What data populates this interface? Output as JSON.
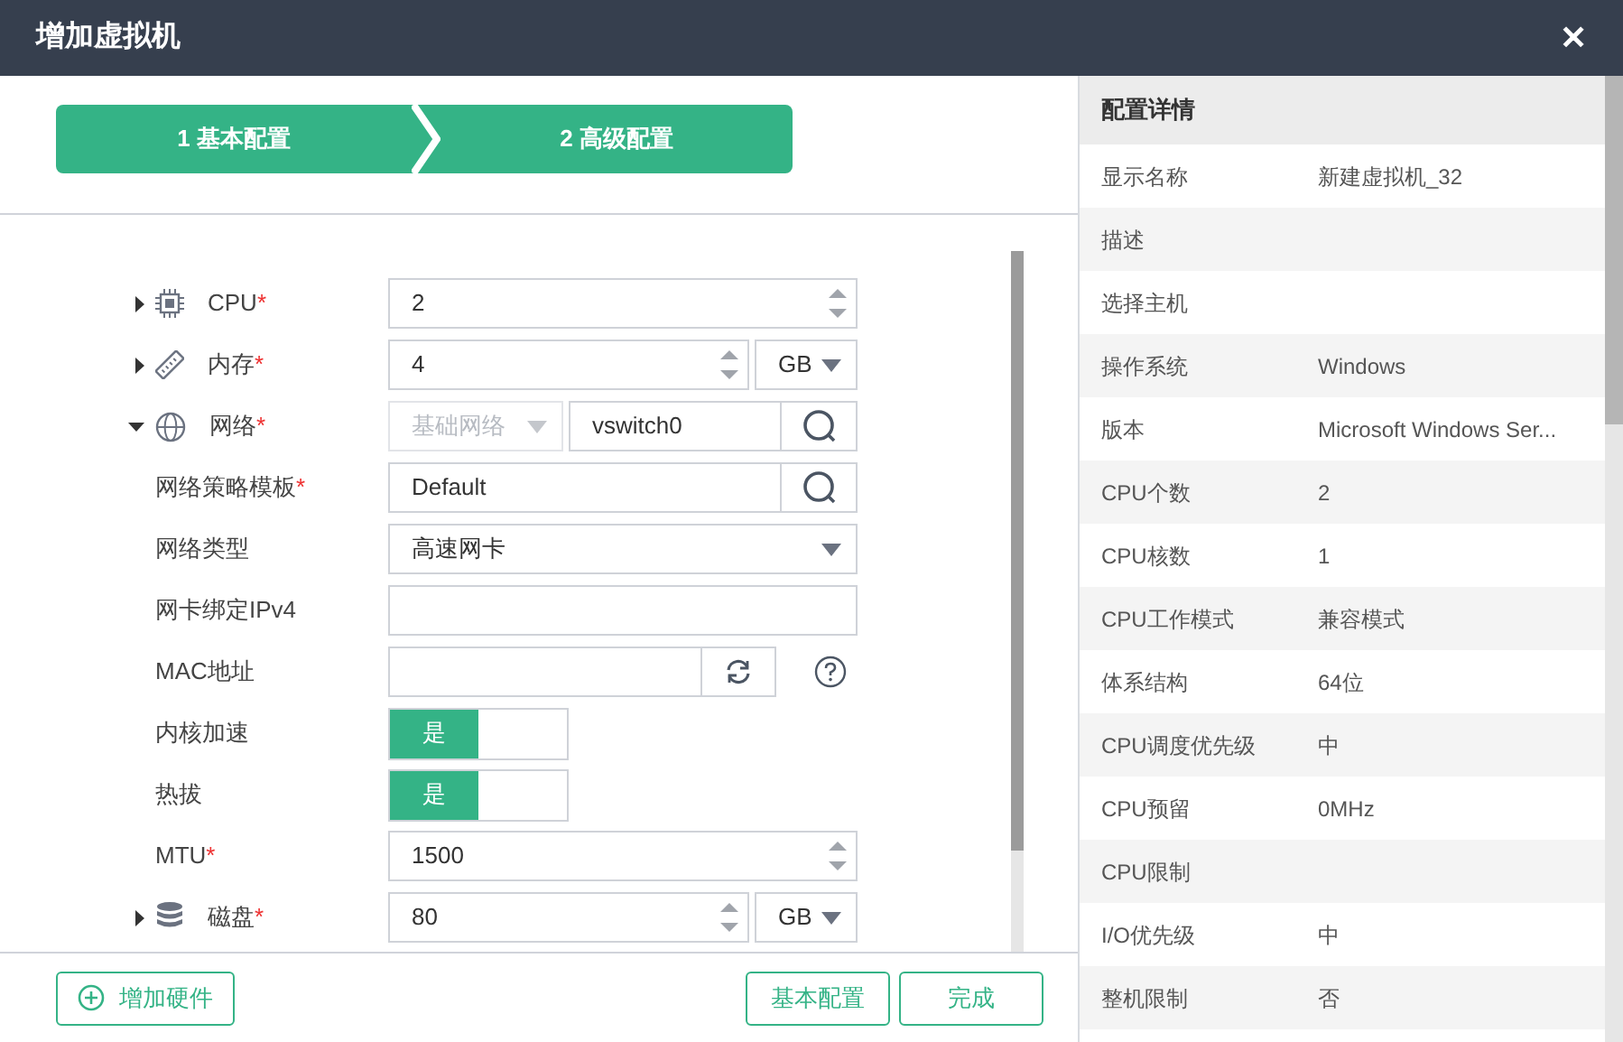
{
  "window": {
    "title": "增加虚拟机",
    "close": "✕"
  },
  "steps": [
    {
      "label": "1 基本配置"
    },
    {
      "label": "2 高级配置"
    }
  ],
  "form": {
    "rows": [
      {
        "kind": "number",
        "label": "CPU",
        "mark": "*",
        "expanded": false,
        "value": "2"
      },
      {
        "kind": "number_unit",
        "label": "内存",
        "mark": "*",
        "expanded": false,
        "value": "4",
        "unit": "GB"
      },
      {
        "kind": "network",
        "label": "网络",
        "mark": "*",
        "expanded": true,
        "select": "基础网络",
        "value": "vswitch0"
      },
      {
        "kind": "search",
        "label": "网络策略模板",
        "mark": "*",
        "value": "Default"
      },
      {
        "kind": "select",
        "label": "网络类型",
        "value": "高速网卡"
      },
      {
        "kind": "text",
        "label": "网卡绑定IPv4"
      },
      {
        "kind": "mac",
        "label": "MAC地址"
      },
      {
        "kind": "toggle",
        "label": "内核加速",
        "on": true,
        "on_label": "是"
      },
      {
        "kind": "toggle",
        "label": "热拔",
        "on": true,
        "on_label": "是"
      },
      {
        "kind": "number",
        "label": "MTU",
        "mark": "*",
        "value": "1500"
      },
      {
        "kind": "number_unit",
        "label": "磁盘",
        "mark": "*",
        "expanded": false,
        "value": "80",
        "unit": "GB"
      }
    ]
  },
  "footer": {
    "add_button": "增加硬件",
    "buttons": [
      "基本配置",
      "完成"
    ]
  },
  "details": {
    "title": "配置详情",
    "rows": [
      {
        "label": "显示名称",
        "value": "新建虚拟机_32"
      },
      {
        "label": "描述"
      },
      {
        "label": "选择主机"
      },
      {
        "label": "操作系统",
        "value": "Windows"
      },
      {
        "label": "版本",
        "value": "Microsoft Windows Ser..."
      },
      {
        "label": "CPU个数",
        "value": "2"
      },
      {
        "label": "CPU核数",
        "value": "1"
      },
      {
        "label": "CPU工作模式",
        "value": "兼容模式"
      },
      {
        "label": "体系结构",
        "value": "64位"
      },
      {
        "label": "CPU调度优先级",
        "value": "中"
      },
      {
        "label": "CPU预留",
        "value": "0MHz"
      },
      {
        "label": "CPU限制"
      },
      {
        "label": "I/O优先级",
        "value": "中"
      },
      {
        "label": "整机限制",
        "value": "否"
      }
    ]
  }
}
